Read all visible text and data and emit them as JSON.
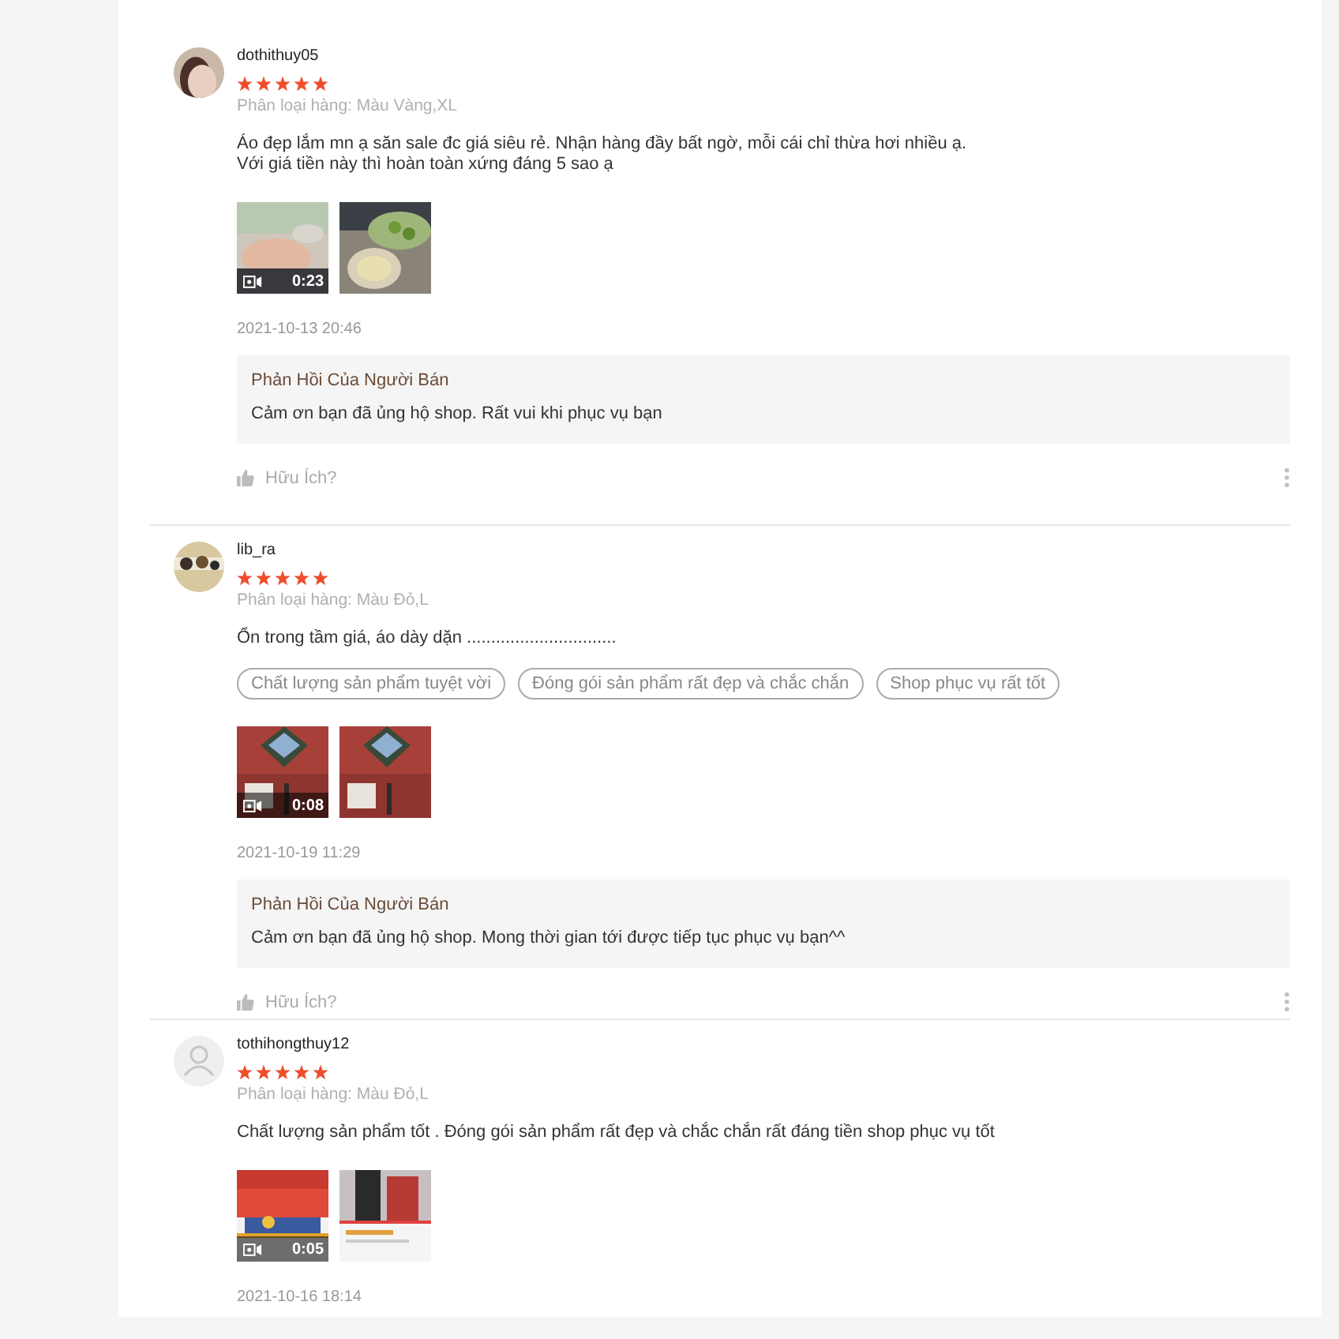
{
  "reviews": [
    {
      "username": "dothithuy05",
      "has_photo": true,
      "stars": 5,
      "variation": "Phân loại hàng: Màu Vàng,XL",
      "comment": [
        "Áo đẹp lắm mn ạ săn sale đc giá siêu rẻ. Nhận hàng đầy bất ngờ, mỗi cái chỉ thừa hơi nhiều ạ.",
        "Với giá tiền này thì hoàn toàn xứng đáng 5 sao ạ"
      ],
      "media": [
        {
          "kind": "video",
          "duration": "0:23"
        },
        {
          "kind": "picture"
        }
      ],
      "date": "2021-10-13 20:46",
      "seller_reply": {
        "title": "Phản Hồi Của Người Bán",
        "text": "Cảm ơn bạn đã ủng hộ shop. Rất vui khi phục vụ bạn"
      },
      "helpful": "Hữu Ích?"
    },
    {
      "username": "lib_ra",
      "has_photo": true,
      "stars": 5,
      "variation": "Phân loại hàng: Màu Đỏ,L",
      "comment": [
        "Ổn trong tầm giá, áo dày dặn ..............................."
      ],
      "tags": [
        "Chất lượng sản phẩm tuyệt vời",
        "Đóng gói sản phẩm rất đẹp và chắc chắn",
        "Shop phục vụ rất tốt"
      ],
      "media": [
        {
          "kind": "video",
          "duration": "0:08"
        },
        {
          "kind": "picture"
        }
      ],
      "date": "2021-10-19 11:29",
      "seller_reply": {
        "title": "Phản Hồi Của Người Bán",
        "text": "Cảm ơn bạn đã ủng hộ shop. Mong thời gian tới được tiếp tục phục vụ bạn^^"
      },
      "helpful": "Hữu Ích?"
    },
    {
      "username": "tothihongthuy12",
      "has_photo": false,
      "stars": 5,
      "variation": "Phân loại hàng: Màu Đỏ,L",
      "comment": [
        "Chất lượng sản phẩm tốt . Đóng gói sản phẩm rất đẹp và chắc chắn rất đáng tiền shop phục vụ tốt"
      ],
      "media": [
        {
          "kind": "video",
          "duration": "0:05"
        },
        {
          "kind": "picture"
        }
      ],
      "date": "2021-10-16 18:14"
    }
  ]
}
